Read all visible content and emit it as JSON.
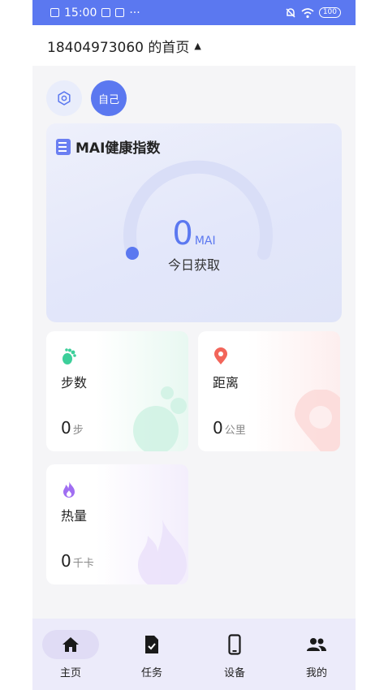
{
  "status_bar": {
    "time": "15:00",
    "extra": "···",
    "battery": "100"
  },
  "header": {
    "title": "18404973060  的首页"
  },
  "toolbar": {
    "self_label": "自己"
  },
  "mai_card": {
    "title": "MAI健康指数",
    "value": "0",
    "unit": "MAI",
    "subtitle": "今日获取"
  },
  "stats": [
    {
      "label": "步数",
      "value": "0",
      "unit": "步",
      "icon": "footprint-icon",
      "color": "#3ccf9a"
    },
    {
      "label": "距离",
      "value": "0",
      "unit": "公里",
      "icon": "location-pin-icon",
      "color": "#f2655a"
    },
    {
      "label": "热量",
      "value": "0",
      "unit": "千卡",
      "icon": "flame-icon",
      "color": "#a06ef2"
    }
  ],
  "tabs": [
    {
      "label": "主页",
      "icon": "home-icon",
      "active": true
    },
    {
      "label": "任务",
      "icon": "task-icon",
      "active": false
    },
    {
      "label": "设备",
      "icon": "phone-device-icon",
      "active": false
    },
    {
      "label": "我的",
      "icon": "people-icon",
      "active": false
    }
  ],
  "colors": {
    "accent": "#5b78f0",
    "gauge_track": "#d9def7",
    "tabbar_bg": "#ecebfa"
  }
}
